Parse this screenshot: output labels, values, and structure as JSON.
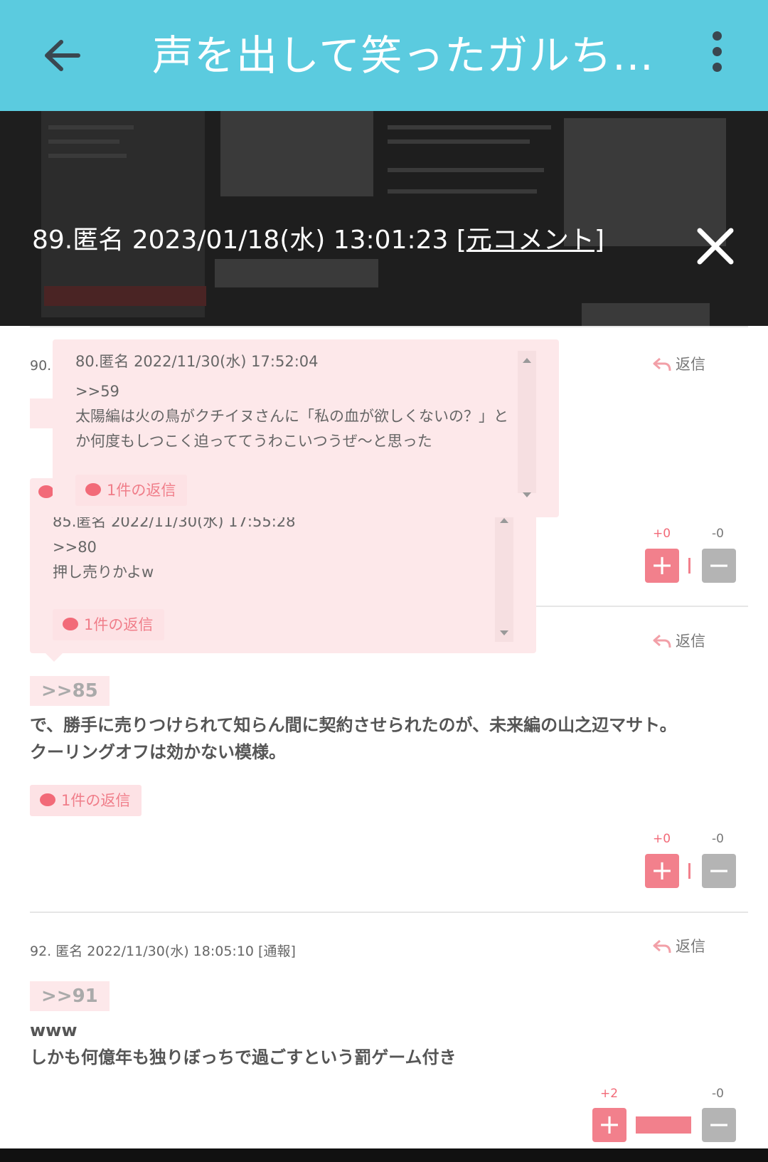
{
  "appbar": {
    "title": "声を出して笑ったガルち..."
  },
  "viewer": {
    "caption_prefix": "89.匿名 2023/01/18(水) 13:01:23 [",
    "caption_link": "元コメント",
    "caption_suffix": "]"
  },
  "comments": [
    {
      "id_partial": "90.",
      "reply_label": "返信",
      "votes": {
        "plus": "+0",
        "minus": "-0"
      }
    },
    {
      "reply_label": "返信",
      "anchor": ">>85",
      "text_line1": "で、勝手に売りつけられて知らん間に契約させられたのが、未来編の山之辺マサト。",
      "text_line2": "クーリングオフは効かない模様。",
      "reply_count": "1件の返信",
      "votes": {
        "plus": "+0",
        "minus": "-0"
      }
    },
    {
      "meta": "92. 匿名 2022/11/30(水) 18:05:10 [通報]",
      "reply_label": "返信",
      "anchor": ">>91",
      "text_line1": "www",
      "text_line2": "しかも何億年も独りぼっちで過ごすという罰ゲーム付き",
      "votes": {
        "plus": "+2",
        "minus": "-0"
      }
    }
  ],
  "popups": [
    {
      "meta": "80.匿名 2022/11/30(水) 17:52:04",
      "anchor": ">>59",
      "text_line1": "太陽編は火の鳥がクチイヌさんに「私の血が欲しくないの？」と",
      "text_line2": "か何度もしつこく迫っててうわこいつうぜ～と思った",
      "reply_count": "1件の返信"
    },
    {
      "meta": "85.匿名 2022/11/30(水) 17:55:28",
      "anchor": ">>80",
      "text_line1": "押し売りかよw",
      "reply_count": "1件の返信"
    }
  ],
  "icons": {
    "back": "arrow-left-icon",
    "more": "more-vert-icon",
    "close": "close-icon",
    "reply": "reply-arrow-icon",
    "bubble": "speech-bubble-icon"
  },
  "colors": {
    "appbar": "#5bcbdf",
    "accent_pink": "#f26a78",
    "popup_bg": "#fde8ea"
  }
}
